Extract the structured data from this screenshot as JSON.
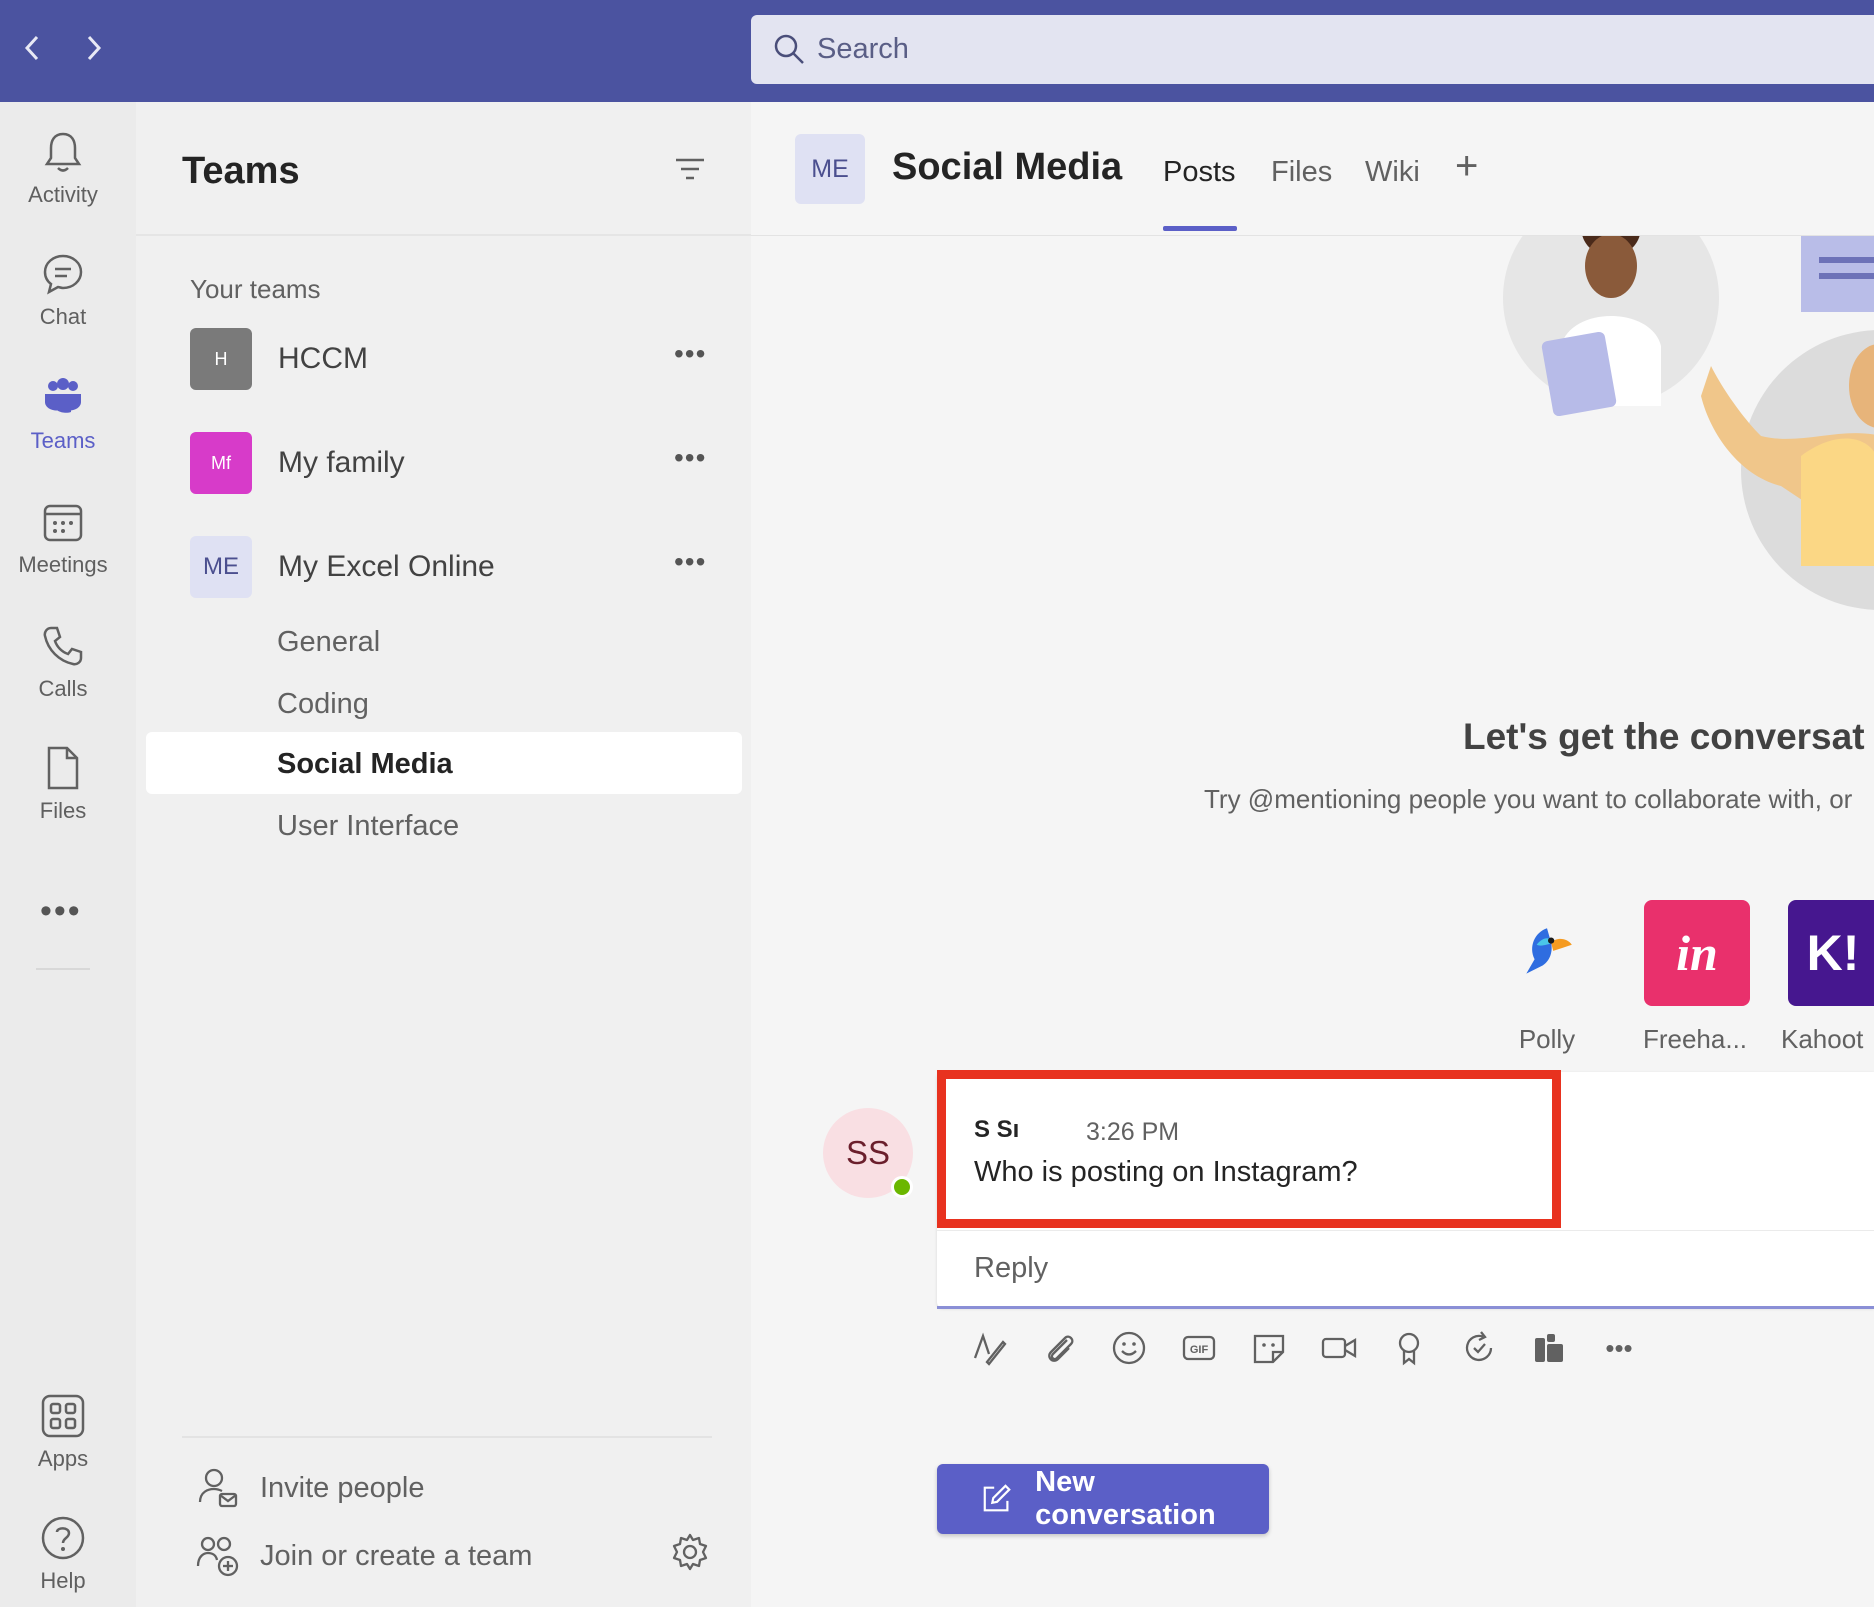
{
  "search": {
    "placeholder": "Search"
  },
  "rail": {
    "items": [
      {
        "label": "Activity",
        "icon": "bell-icon"
      },
      {
        "label": "Chat",
        "icon": "chat-icon"
      },
      {
        "label": "Teams",
        "icon": "teams-icon",
        "active": true
      },
      {
        "label": "Meetings",
        "icon": "calendar-icon"
      },
      {
        "label": "Calls",
        "icon": "phone-icon"
      },
      {
        "label": "Files",
        "icon": "file-icon"
      }
    ],
    "more": "•••",
    "bottom": [
      {
        "label": "Apps",
        "icon": "apps-icon"
      },
      {
        "label": "Help",
        "icon": "help-icon"
      }
    ]
  },
  "panel": {
    "title": "Teams",
    "section": "Your teams",
    "teams": [
      {
        "initials": "H",
        "name": "HCCM",
        "color": "#7a7a7a"
      },
      {
        "initials": "Mf",
        "name": "My family",
        "color": "#d73bc9"
      },
      {
        "initials": "ME",
        "name": "My Excel Online",
        "color": "#dfe1f3"
      }
    ],
    "more": "•••",
    "channels": [
      "General",
      "Coding",
      "Social Media",
      "User Interface"
    ],
    "active_channel": "Social Media",
    "invite": "Invite people",
    "join": "Join or create a team"
  },
  "channel": {
    "initials": "ME",
    "title": "Social Media",
    "tabs": [
      "Posts",
      "Files",
      "Wiki"
    ],
    "active_tab": "Posts",
    "add": "+"
  },
  "welcome": {
    "title": "Let's get the conversat",
    "subtitle": "Try @mentioning people you want to collaborate with, or"
  },
  "apps": [
    {
      "label": "Polly",
      "tile": ""
    },
    {
      "label": "Freeha...",
      "tile": "in"
    },
    {
      "label": "Kahoot",
      "tile": "K!"
    }
  ],
  "message": {
    "initials": "SS",
    "sender": "S Sı",
    "time": "3:26 PM",
    "body": "Who is posting on Instagram?",
    "reply": "Reply"
  },
  "new_conversation": "New conversation",
  "colors": {
    "topbar": "#4b53a0",
    "accent": "#5b5fc7",
    "highlight": "#e8321f"
  }
}
